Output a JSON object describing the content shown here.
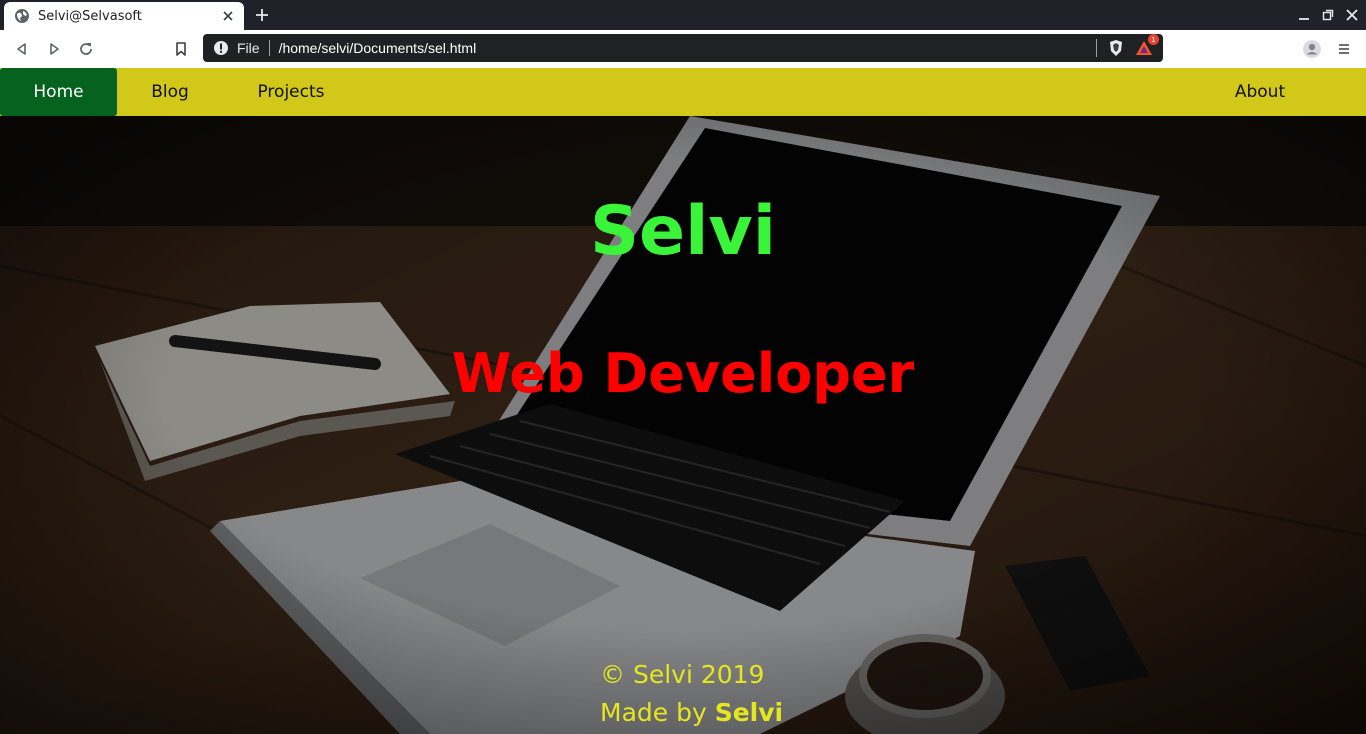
{
  "browser": {
    "tab": {
      "title": "Selvi@Selvasoft",
      "favicon": "globe-icon"
    },
    "omnibox": {
      "scheme_label": "File",
      "url": "/home/selvi/Documents/sel.html"
    },
    "extension_badge": "1"
  },
  "site": {
    "nav": {
      "items": [
        {
          "label": "Home",
          "active": true
        },
        {
          "label": "Blog"
        },
        {
          "label": "Projects"
        }
      ],
      "right_item": {
        "label": "About"
      }
    },
    "hero": {
      "name": "Selvi",
      "role": "Web Developer"
    },
    "footer": {
      "copyright": "© Selvi 2019",
      "made_by_prefix": "Made by",
      "made_by_name": "Selvi"
    }
  },
  "colors": {
    "nav_bg": "#d2c81a",
    "nav_active": "#06621f",
    "name": "#3af43a",
    "role": "#ff0000",
    "footer_text": "#e4e620"
  }
}
